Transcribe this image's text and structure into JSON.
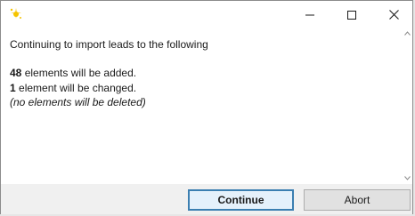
{
  "window": {
    "icon": "app-sparkle-icon",
    "controls": {
      "minimize": "minimize-icon",
      "maximize": "maximize-icon",
      "close": "close-icon"
    }
  },
  "message": {
    "heading": "Continuing to import leads to the following",
    "added_count": "48",
    "added_text": " elements will be added.",
    "changed_count": "1",
    "changed_text": " element will be changed.",
    "deleted_text": "(no elements will be deleted)"
  },
  "buttons": {
    "continue_label": "Continue",
    "abort_label": "Abort"
  },
  "colors": {
    "accent_border": "#3c7fb1",
    "accent_fill": "#e5f1fb",
    "icon_yellow": "#f5c400"
  }
}
